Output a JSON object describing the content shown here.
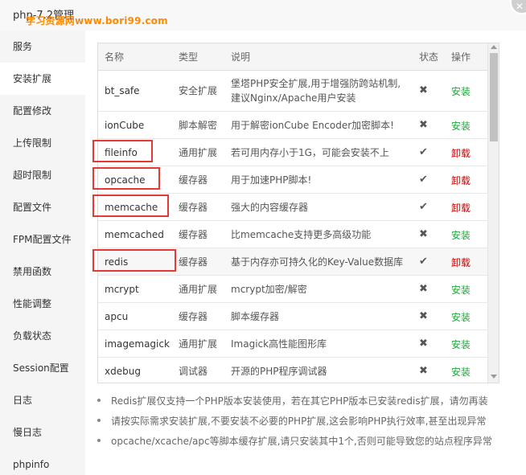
{
  "window": {
    "title": "php-7.2管理",
    "watermark": "学习资源网www.bori99.com"
  },
  "sidebar": {
    "items": [
      {
        "label": "服务"
      },
      {
        "label": "安装扩展",
        "active": true
      },
      {
        "label": "配置修改"
      },
      {
        "label": "上传限制"
      },
      {
        "label": "超时限制"
      },
      {
        "label": "配置文件"
      },
      {
        "label": "FPM配置文件"
      },
      {
        "label": "禁用函数"
      },
      {
        "label": "性能调整"
      },
      {
        "label": "负载状态"
      },
      {
        "label": "Session配置"
      },
      {
        "label": "日志"
      },
      {
        "label": "慢日志"
      },
      {
        "label": "phpinfo"
      }
    ]
  },
  "table": {
    "headers": {
      "name": "名称",
      "type": "类型",
      "desc": "说明",
      "status": "状态",
      "action": "操作"
    },
    "rows": [
      {
        "name": "bt_safe",
        "type": "安全扩展",
        "desc1": "堡塔PHP安全扩展,用于增强防跨站机制,",
        "desc2": "建议Nginx/Apache用户安装",
        "status": "✖",
        "action": "安装",
        "action_kind": "install"
      },
      {
        "name": "ionCube",
        "type": "脚本解密",
        "desc1": "用于解密ionCube Encoder加密脚本!",
        "desc2": "",
        "status": "✖",
        "action": "安装",
        "action_kind": "install"
      },
      {
        "name": "fileinfo",
        "type": "通用扩展",
        "desc1": "若可用内存小于1G，可能会安装不上",
        "desc2": "",
        "status": "✔",
        "action": "卸载",
        "action_kind": "uninstall",
        "highlighted": true
      },
      {
        "name": "opcache",
        "type": "缓存器",
        "desc1": "用于加速PHP脚本!",
        "desc2": "",
        "status": "✔",
        "action": "卸载",
        "action_kind": "uninstall",
        "highlighted": true
      },
      {
        "name": "memcache",
        "type": "缓存器",
        "desc1": "强大的内容缓存器",
        "desc2": "",
        "status": "✔",
        "action": "卸载",
        "action_kind": "uninstall",
        "highlighted": true
      },
      {
        "name": "memcached",
        "type": "缓存器",
        "desc1": "比memcache支持更多高级功能",
        "desc2": "",
        "status": "✖",
        "action": "安装",
        "action_kind": "install"
      },
      {
        "name": "redis",
        "type": "缓存器",
        "desc1": "基于内存亦可持久化的Key-Value数据库",
        "desc2": "",
        "status": "✔",
        "action": "卸载",
        "action_kind": "uninstall",
        "highlighted": true
      },
      {
        "name": "mcrypt",
        "type": "通用扩展",
        "desc1": "mcrypt加密/解密",
        "desc2": "",
        "status": "✖",
        "action": "安装",
        "action_kind": "install"
      },
      {
        "name": "apcu",
        "type": "缓存器",
        "desc1": "脚本缓存器",
        "desc2": "",
        "status": "✖",
        "action": "安装",
        "action_kind": "install"
      },
      {
        "name": "imagemagick",
        "type": "通用扩展",
        "desc1": "Imagick高性能图形库",
        "desc2": "",
        "status": "✖",
        "action": "安装",
        "action_kind": "install"
      },
      {
        "name": "xdebug",
        "type": "调试器",
        "desc1": "开源的PHP程序调试器",
        "desc2": "",
        "status": "✖",
        "action": "安装",
        "action_kind": "install"
      }
    ]
  },
  "notes": [
    "Redis扩展仅支持一个PHP版本安装使用，若在其它PHP版本已安装redis扩展，请勿再装",
    "请按实际需求安装扩展,不要安装不必要的PHP扩展,这会影响PHP执行效率,甚至出现异常",
    "opcache/xcache/apc等脚本缓存扩展,请只安装其中1个,否则可能导致您的站点程序异常"
  ],
  "colors": {
    "install": "#20a53a",
    "uninstall": "#cc0000",
    "highlight": "#e53935",
    "watermark": "#ff8a00"
  }
}
